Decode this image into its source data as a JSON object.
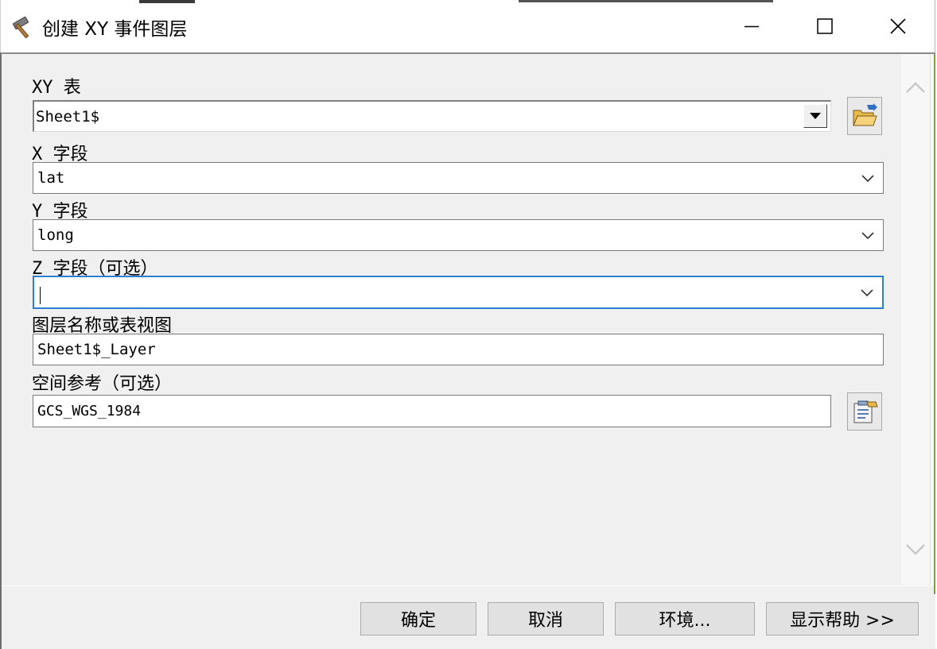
{
  "window": {
    "title": "创建 XY 事件图层",
    "icon": "hammer-icon",
    "controls": [
      "minimize-icon",
      "maximize-icon",
      "close-icon"
    ]
  },
  "form": {
    "xy_table": {
      "label": "XY 表",
      "value": "Sheet1$"
    },
    "x_field": {
      "label": "X 字段",
      "value": "lat"
    },
    "y_field": {
      "label": "Y 字段",
      "value": "long"
    },
    "z_field": {
      "label": "Z 字段（可选）",
      "value": ""
    },
    "layer_name": {
      "label": "图层名称或表视图",
      "value": "Sheet1$_Layer"
    },
    "spatial_ref": {
      "label": "空间参考（可选）",
      "value": "GCS_WGS_1984"
    }
  },
  "buttons": {
    "ok": "确定",
    "cancel": "取消",
    "environments": "环境...",
    "show_help": "显示帮助 >>"
  },
  "colors": {
    "focus_border": "#2a7fd1",
    "dialog_background": "#f0f0f0",
    "title_background": "#ffffff"
  }
}
